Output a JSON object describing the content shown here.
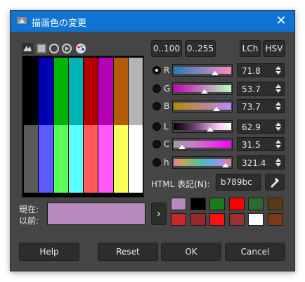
{
  "window": {
    "title": "描画色の変更",
    "close_icon": "close-icon"
  },
  "modes": {
    "range_100": "0..100",
    "range_255": "0..255",
    "lch": "LCh",
    "hsv": "HSV"
  },
  "channels": [
    {
      "name": "R",
      "value": "71.8",
      "selected": true,
      "gradient": "linear-gradient(to right,#1e7fbd,#ff8bbd)",
      "marker": 0.72
    },
    {
      "name": "G",
      "value": "53.7",
      "selected": false,
      "gradient": "linear-gradient(to right,#c400bc,#b9ffbc)",
      "marker": 0.54
    },
    {
      "name": "B",
      "value": "73.7",
      "selected": false,
      "gradient": "linear-gradient(to right,#b98900,#b98aff)",
      "marker": 0.74
    },
    {
      "name": "L",
      "value": "62.9",
      "selected": false,
      "gradient": "linear-gradient(to right,#000000,#3a1e3b 20%,#7a4a7b 40%,#c98bca 60%,#ffd0ff 80%,#ffffff)",
      "marker": 0.63
    },
    {
      "name": "C",
      "value": "31.5",
      "selected": false,
      "gradient": "linear-gradient(to right,#9d9d9d,#c47fc8 35%,#ff00ff 100%)",
      "marker": 0.16
    },
    {
      "name": "h",
      "value": "321.4",
      "selected": false,
      "gradient": "linear-gradient(to right,#e27f8a,#c9a55a 16%,#7fb87a 33%,#4dbcbc 50%,#6aa6ea 66%,#a98ee8 83%,#e27f8a)",
      "marker": 0.89
    }
  ],
  "html_label": "HTML 表記(N):",
  "html_value": "b789bc",
  "current_label": "現在:",
  "previous_label": "以前:",
  "current_color": "#b789bc",
  "swatch_grid": {
    "top": [
      "#000000",
      "#0000b4",
      "#00b400",
      "#00b4b4",
      "#b40000",
      "#b400b4",
      "#b45a00",
      "#b4b4b4"
    ],
    "bottom": [
      "#5a5a5a",
      "#5a5aff",
      "#5aff5a",
      "#5affff",
      "#ff5a5a",
      "#ff5aff",
      "#ffff5a",
      "#ffffff"
    ]
  },
  "history": [
    "#b789bc",
    "#000000",
    "#1c7c1c",
    "#ff0000",
    "#2e6b2e",
    "#5a3a12",
    "#c42a2a",
    "#9a2a2a",
    "#ff1010",
    "#9a3030",
    "#ffffff",
    "#7a3a12"
  ],
  "buttons": {
    "help": "Help",
    "reset": "Reset",
    "ok": "OK",
    "cancel": "Cancel"
  },
  "toolbar_icons": [
    "scales-icon",
    "cmyk-icon",
    "watercolor-icon",
    "wheel-icon",
    "palette-icon"
  ]
}
